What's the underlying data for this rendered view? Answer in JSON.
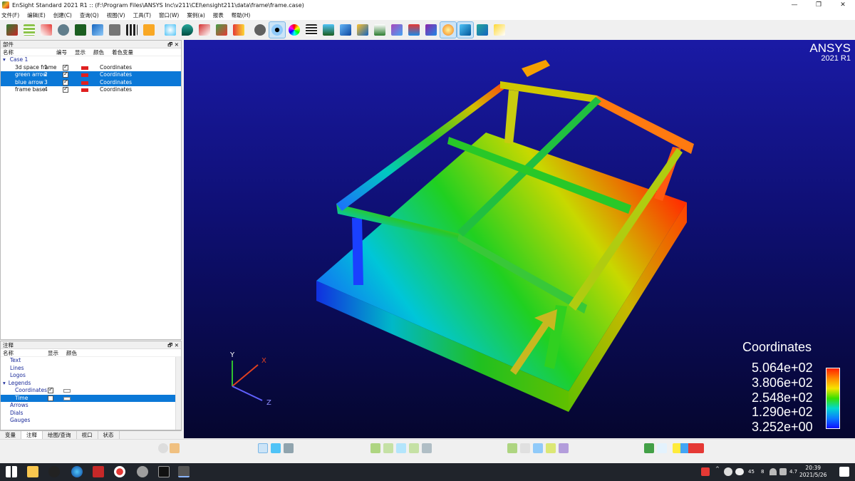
{
  "window": {
    "title": "EnSight Standard 2021 R1 :: (F:\\Program Files\\ANSYS Inc\\v211\\CEI\\ensight211\\data\\frame\\frame.case)",
    "minimize": "—",
    "restore": "❐",
    "close": "✕"
  },
  "menu": [
    "文件(F)",
    "编辑(E)",
    "创建(C)",
    "查询(Q)",
    "视图(V)",
    "工具(T)",
    "窗口(W)",
    "案例(a)",
    "报表",
    "帮助(H)"
  ],
  "parts_panel": {
    "title": "部件",
    "controls": "🗗 ✕",
    "headers": {
      "name": "名称",
      "id": "编号",
      "visible": "显示",
      "color": "颜色",
      "variable": "着色变量"
    },
    "case_label": "Case 1",
    "rows": [
      {
        "name": "3d space frame",
        "id": "1",
        "visible": true,
        "color": "#e02020",
        "variable": "Coordinates",
        "selected": false
      },
      {
        "name": "green arrow",
        "id": "2",
        "visible": true,
        "color": "#e02020",
        "variable": "Coordinates",
        "selected": true
      },
      {
        "name": "blue arrow",
        "id": "3",
        "visible": true,
        "color": "#e02020",
        "variable": "Coordinates",
        "selected": true
      },
      {
        "name": "frame base",
        "id": "4",
        "visible": true,
        "color": "#e02020",
        "variable": "Coordinates",
        "selected": false
      }
    ]
  },
  "annotation_panel": {
    "title": "注释",
    "controls": "🗗 ✕",
    "headers": {
      "name": "名称",
      "visible": "显示",
      "color": "颜色"
    },
    "items": [
      "Text",
      "Lines",
      "Logos"
    ],
    "legends_label": "Legends",
    "legend_rows": [
      {
        "name": "Coordinates",
        "visible": true,
        "selected": false
      },
      {
        "name": "Time",
        "visible": false,
        "selected": true
      }
    ],
    "more_items": [
      "Arrows",
      "Dials",
      "Gauges"
    ]
  },
  "tabs": [
    "变量",
    "注释",
    "绘图/查询",
    "视口",
    "状态"
  ],
  "active_tab": "注释",
  "viewport": {
    "brand": "ANSYS",
    "version": "2021 R1",
    "axes": {
      "x": "X",
      "y": "Y",
      "z": "Z"
    },
    "legend_title": "Coordinates",
    "legend_values": [
      "5.064e+02",
      "3.806e+02",
      "2.548e+02",
      "1.290e+02",
      "3.252e+00"
    ]
  },
  "taskbar": {
    "time": "20:39",
    "date": "2021/5/26",
    "tray_text": [
      "45",
      "8",
      "4.7"
    ]
  }
}
